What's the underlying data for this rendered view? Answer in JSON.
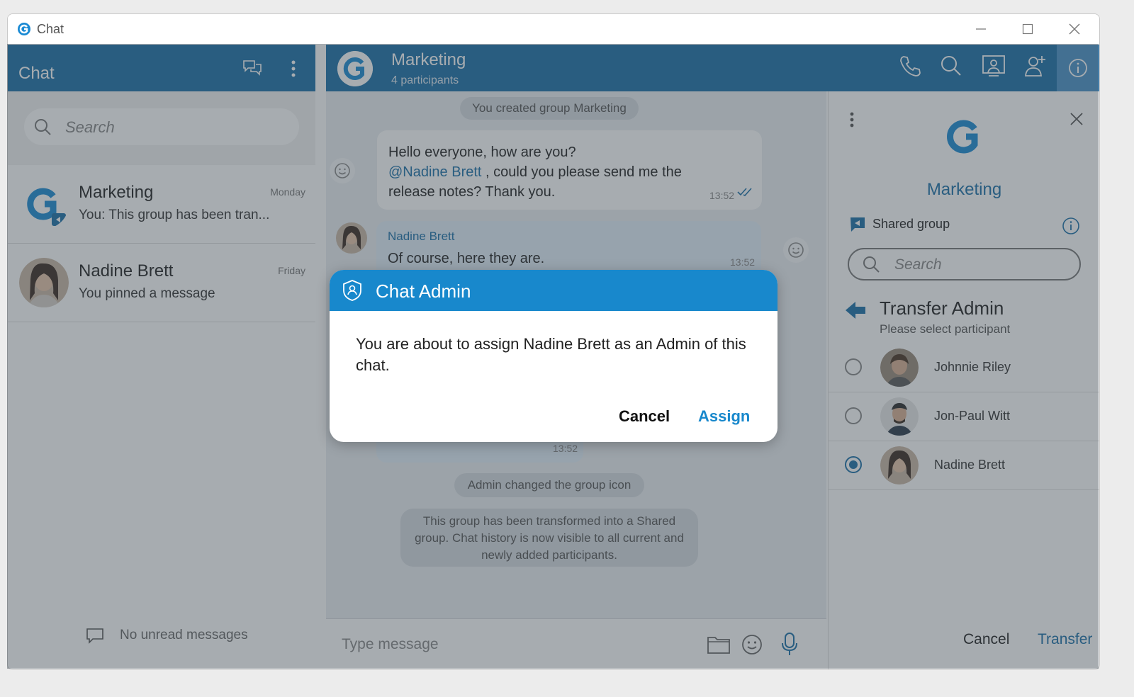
{
  "window": {
    "title": "Chat"
  },
  "sidebar": {
    "title": "Chat",
    "search_placeholder": "Search",
    "conversations": [
      {
        "name": "Marketing",
        "time": "Monday",
        "preview": "You: This group has been tran..."
      },
      {
        "name": "Nadine Brett",
        "time": "Friday",
        "preview": "You pinned a message"
      }
    ],
    "footer": "No unread messages"
  },
  "chat": {
    "name": "Marketing",
    "subtitle": "4 participants",
    "system_created": "You created group Marketing",
    "msg1": {
      "line1": "Hello everyone, how are you?",
      "mention": "@Nadine Brett",
      "line2": " , could you please send me the",
      "line3": "release notes? Thank you.",
      "time": "13:52"
    },
    "msg2": {
      "author": "Nadine Brett",
      "text": "Of course, here they are.",
      "time": "13:52"
    },
    "msg3_time": "13:52",
    "system_icon": "Admin changed the group icon",
    "system_shared": "This group has been transformed into a Shared group. Chat history is now visible to all current and newly added participants.",
    "composer_placeholder": "Type message"
  },
  "info_panel": {
    "group_name": "Marketing",
    "shared_label": "Shared group",
    "search_placeholder": "Search",
    "transfer_title": "Transfer Admin",
    "transfer_subtitle": "Please select participant",
    "participants": [
      {
        "name": "Johnnie Riley",
        "selected": false
      },
      {
        "name": "Jon-Paul Witt",
        "selected": false
      },
      {
        "name": "Nadine Brett",
        "selected": true
      }
    ],
    "cancel": "Cancel",
    "transfer": "Transfer"
  },
  "dialog": {
    "title": "Chat Admin",
    "message": "You are about to assign Nadine Brett as an Admin of this chat.",
    "cancel": "Cancel",
    "assign": "Assign"
  },
  "colors": {
    "brand": "#1a6fa8",
    "dialog_header": "#1888cc",
    "overlay": "rgba(60,70,80,0.45)"
  }
}
